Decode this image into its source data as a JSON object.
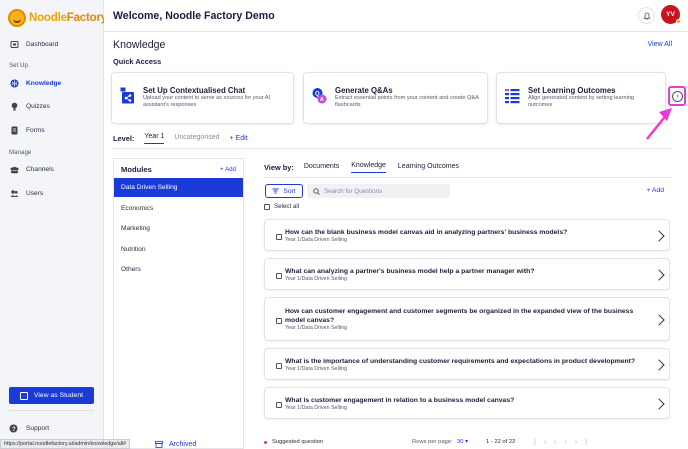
{
  "brand": {
    "name_part1": "Noodle",
    "name_part2": "Factory"
  },
  "sidebar": {
    "items": [
      {
        "label": "Dashboard",
        "icon": "dashboard-icon"
      },
      {
        "label": "Knowledge",
        "icon": "knowledge-icon",
        "active": true
      },
      {
        "label": "Quizzes",
        "icon": "quiz-icon"
      },
      {
        "label": "Forms",
        "icon": "forms-icon"
      },
      {
        "label": "Channels",
        "icon": "channels-icon"
      },
      {
        "label": "Users",
        "icon": "users-icon"
      }
    ],
    "sections": {
      "setup": "Set Up",
      "manage": "Manage"
    },
    "view_student": "View as Student",
    "support": "Support"
  },
  "header": {
    "welcome": "Welcome, Noodle Factory Demo",
    "avatar_initials": "YV"
  },
  "page": {
    "title": "Knowledge",
    "view_all": "View All",
    "quick_access": "Quick Access"
  },
  "cards": [
    {
      "title": "Set Up Contextualised Chat",
      "desc": "Upload your content to serve as sources for your AI assistant's responses"
    },
    {
      "title": "Generate Q&As",
      "desc": "Extract essential points from your content and create Q&A flashcards"
    },
    {
      "title": "Set Learning Outcomes",
      "desc": "Align generated content by setting learning outcomes"
    }
  ],
  "level": {
    "label": "Level:",
    "tabs": [
      "Year 1",
      "Uncategorised"
    ],
    "edit": "+ Edit"
  },
  "modules": {
    "heading": "Modules",
    "add": "+ Add",
    "items": [
      "Data Driven Selling",
      "Economics",
      "Marketing",
      "Nutrition",
      "Others"
    ],
    "archived": "Archived"
  },
  "viewby": {
    "label": "View by:",
    "tabs": [
      "Documents",
      "Knowledge",
      "Learning Outcomes"
    ]
  },
  "toolbar": {
    "sort": "Sort",
    "search_placeholder": "Search for Questions",
    "add": "+ Add",
    "select_all": "Select all"
  },
  "questions": [
    {
      "title": "How can the blank business model canvas aid in analyzing partners' business models?",
      "sub": "Year 1/Data Driven Selling"
    },
    {
      "title": "What can analyzing a partner's business model help a partner manager with?",
      "sub": "Year 1/Data Driven Selling"
    },
    {
      "title": "How can customer engagement and customer segments be organized in the expanded view of the business model canvas?",
      "sub": "Year 1/Data Driven Selling"
    },
    {
      "title": "What is the importance of understanding customer requirements and expectations in product development?",
      "sub": "Year 1/Data Driven Selling"
    },
    {
      "title": "What is customer engagement in relation to a business model canvas?",
      "sub": "Year 1/Data Driven Selling"
    }
  ],
  "footer": {
    "suggested": "Suggested question",
    "rows_label": "Rows per page:",
    "rows_value": "30",
    "range": "1 - 22 of 22"
  },
  "status_url": "https://portal.noodlefactory.ai/admin/knowledge/all#",
  "colors": {
    "accent": "#1a3bd8",
    "highlight": "#e73bd4",
    "avatar": "#c8141e",
    "brand": "#f4a300"
  }
}
